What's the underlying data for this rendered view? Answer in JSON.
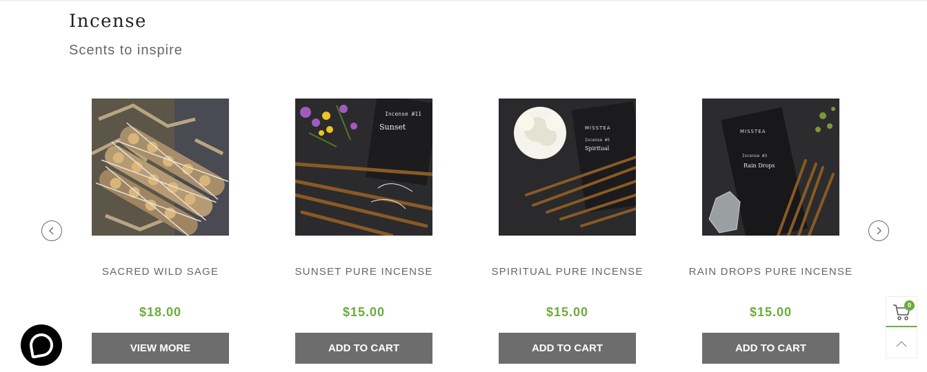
{
  "section": {
    "title": "Incense",
    "subtitle": "Scents to inspire"
  },
  "carousel": {
    "prev_icon": "chevron-left-icon",
    "next_icon": "chevron-right-icon"
  },
  "products": [
    {
      "name": "SACRED WILD SAGE",
      "price": "$18.00",
      "button": "VIEW MORE",
      "image": "sage-bundles-photo"
    },
    {
      "name": "SUNSET PURE INCENSE",
      "price": "$15.00",
      "button": "ADD TO CART",
      "image": "sunset-incense-photo",
      "package_text": "Incense #11",
      "package_title": "Sunset"
    },
    {
      "name": "SPIRITUAL PURE INCENSE",
      "price": "$15.00",
      "button": "ADD TO CART",
      "image": "spiritual-incense-photo",
      "package_brand": "MISSTEA",
      "package_text": "Incense #5",
      "package_title": "Spiritual"
    },
    {
      "name": "RAIN DROPS PURE INCENSE",
      "price": "$15.00",
      "button": "ADD TO CART",
      "image": "rain-drops-incense-photo",
      "package_brand": "MISSTEA",
      "package_text": "Incense #3",
      "package_title": "Rain Drops"
    }
  ],
  "cart": {
    "count": "0",
    "icon": "cart-icon"
  },
  "back_to_top": {
    "icon": "chevron-up-icon"
  },
  "chat": {
    "icon": "chat-bubble-icon"
  },
  "colors": {
    "price": "#6aac3c",
    "button_bg": "#6d6d6d",
    "accent": "#6aac3c"
  }
}
